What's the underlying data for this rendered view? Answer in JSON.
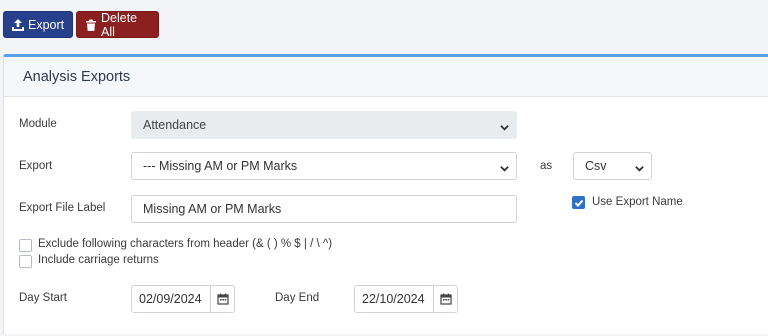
{
  "toolbar": {
    "export_label": "Export",
    "delete_all_label": "Delete All"
  },
  "panel": {
    "title": "Analysis Exports"
  },
  "form": {
    "module": {
      "label": "Module",
      "value": "Attendance"
    },
    "export": {
      "label": "Export",
      "value": "--- Missing AM or PM Marks"
    },
    "as_label": "as",
    "format": {
      "value": "Csv"
    },
    "file_label": {
      "label": "Export File Label",
      "value": "Missing AM or PM Marks"
    },
    "use_export_name": {
      "label": "Use Export Name",
      "checked": true
    },
    "exclude_chars": {
      "label": "Exclude following characters from header (& ( ) % $ | / \\ ^)",
      "checked": false
    },
    "carriage_returns": {
      "label": "Include carriage returns",
      "checked": false
    },
    "day_start": {
      "label": "Day Start",
      "value": "02/09/2024"
    },
    "day_end": {
      "label": "Day End",
      "value": "22/10/2024"
    }
  },
  "colors": {
    "export_button": "#26408c",
    "delete_button": "#8c1f1f",
    "accent": "#5b9ee8",
    "checkbox_checked": "#2f72c8"
  }
}
